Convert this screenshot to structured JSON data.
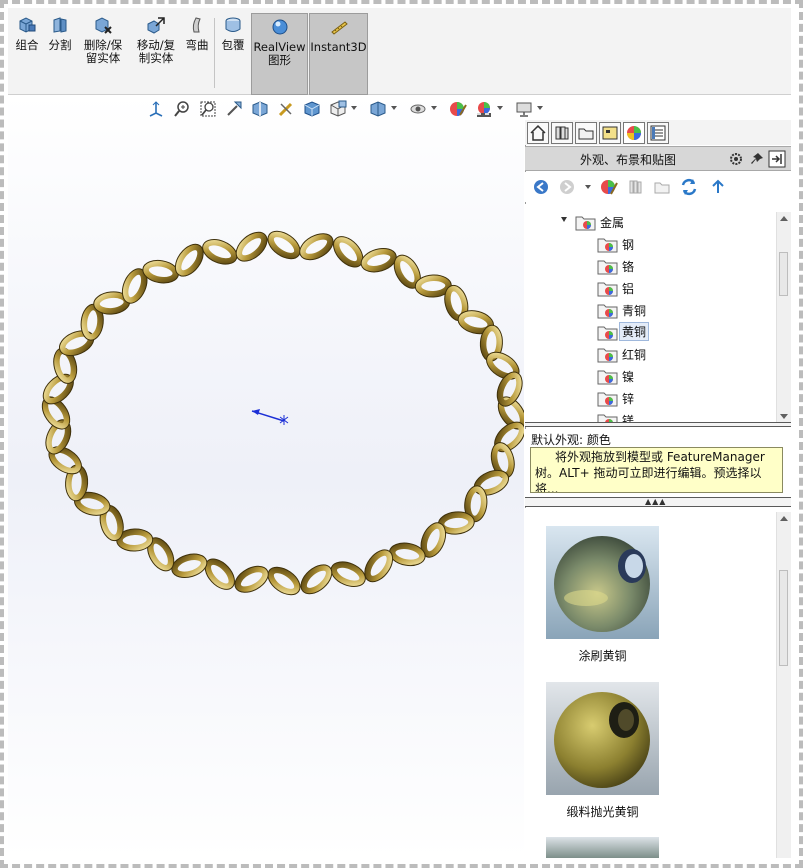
{
  "toolbar": {
    "buttons": [
      {
        "name": "combine",
        "label": "组合"
      },
      {
        "name": "split",
        "label": "分割"
      },
      {
        "name": "delete-keep",
        "label_line1": "删除/保",
        "label_line2": "留实体"
      },
      {
        "name": "move-copy",
        "label_line1": "移动/复",
        "label_line2": "制实体"
      },
      {
        "name": "flex",
        "label": "弯曲"
      },
      {
        "name": "wrap",
        "label": "包覆"
      },
      {
        "name": "realview",
        "label_line1": "RealView",
        "label_line2": "图形"
      },
      {
        "name": "instant3d",
        "label": "Instant3D"
      }
    ]
  },
  "hud": {
    "icons": [
      "view-orientation-icon",
      "zoom-to-fit-icon",
      "zoom-area-icon",
      "previous-view-icon",
      "section-view-icon",
      "dynamic-annotation-icon",
      "view-cube-icon",
      "display-style-icon",
      "hide-show-icon",
      "edit-appearance-icon",
      "apply-scene-icon",
      "view-settings-icon"
    ]
  },
  "taskpane": {
    "title": "外观、布景和贴图",
    "tree": {
      "folder": "金属",
      "items": [
        "钢",
        "铬",
        "铝",
        "青铜",
        "黄铜",
        "红铜",
        "镍",
        "锌",
        "镁"
      ],
      "selected": "黄铜"
    },
    "default_appearance": "默认外观: 颜色",
    "tooltip": "将外观拖放到模型或 FeatureManager 树。ALT+ 拖动可立即进行编辑。预选择以将...",
    "swatches": [
      {
        "name": "涂刷黄铜"
      },
      {
        "name": "缎料抛光黄铜"
      }
    ]
  },
  "colors": {
    "chain_gold": "#b59a3a",
    "toolbar_bg": "#f3f3f3",
    "tooltip_bg": "#ffffc8",
    "triad_blue": "#1c2fd6"
  }
}
